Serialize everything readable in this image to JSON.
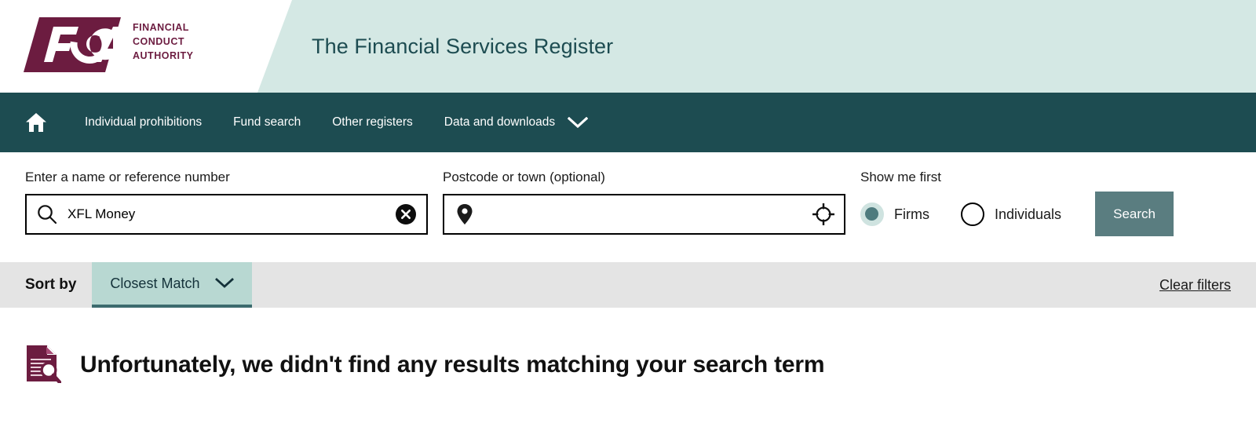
{
  "header": {
    "logo": {
      "mark_text": "FCA",
      "line1": "Financial",
      "line2": "Conduct",
      "line3": "Authority",
      "brand_color": "#6c1c40"
    },
    "title": "The Financial Services Register",
    "band_color": "#d4e8e4",
    "title_color": "#1d4c51"
  },
  "nav": {
    "home_icon": "home-icon",
    "bg_color": "#1d4c51",
    "items": [
      {
        "label": "Individual prohibitions",
        "caret": false
      },
      {
        "label": "Fund search",
        "caret": false
      },
      {
        "label": "Other registers",
        "caret": false
      },
      {
        "label": "Data and downloads",
        "caret": true
      }
    ]
  },
  "search": {
    "name_field": {
      "label": "Enter a name or reference number",
      "value": "XFL Money",
      "placeholder": "",
      "lead_icon": "search-icon",
      "trail_icon": "clear-circle-icon"
    },
    "postcode_field": {
      "label": "Postcode or town (optional)",
      "value": "",
      "placeholder": "",
      "lead_icon": "map-pin-icon",
      "trail_icon": "crosshair-locate-icon"
    },
    "show_me_first": {
      "label": "Show me first",
      "options": [
        {
          "label": "Firms",
          "selected": true
        },
        {
          "label": "Individuals",
          "selected": false
        }
      ]
    },
    "search_button": {
      "label": "Search",
      "color": "#5a7d80"
    }
  },
  "sortbar": {
    "label": "Sort by",
    "selected": "Closest Match",
    "caret_icon": "chevron-down-icon",
    "select_color": "#b8d8d2",
    "underline_color": "#3c6b6e",
    "bg_color": "#e4e4e4",
    "clear_filters": "Clear filters"
  },
  "results": {
    "icon": "document-search-icon",
    "icon_color": "#6c1c40",
    "message": "Unfortunately, we didn't find any results matching your search term"
  }
}
